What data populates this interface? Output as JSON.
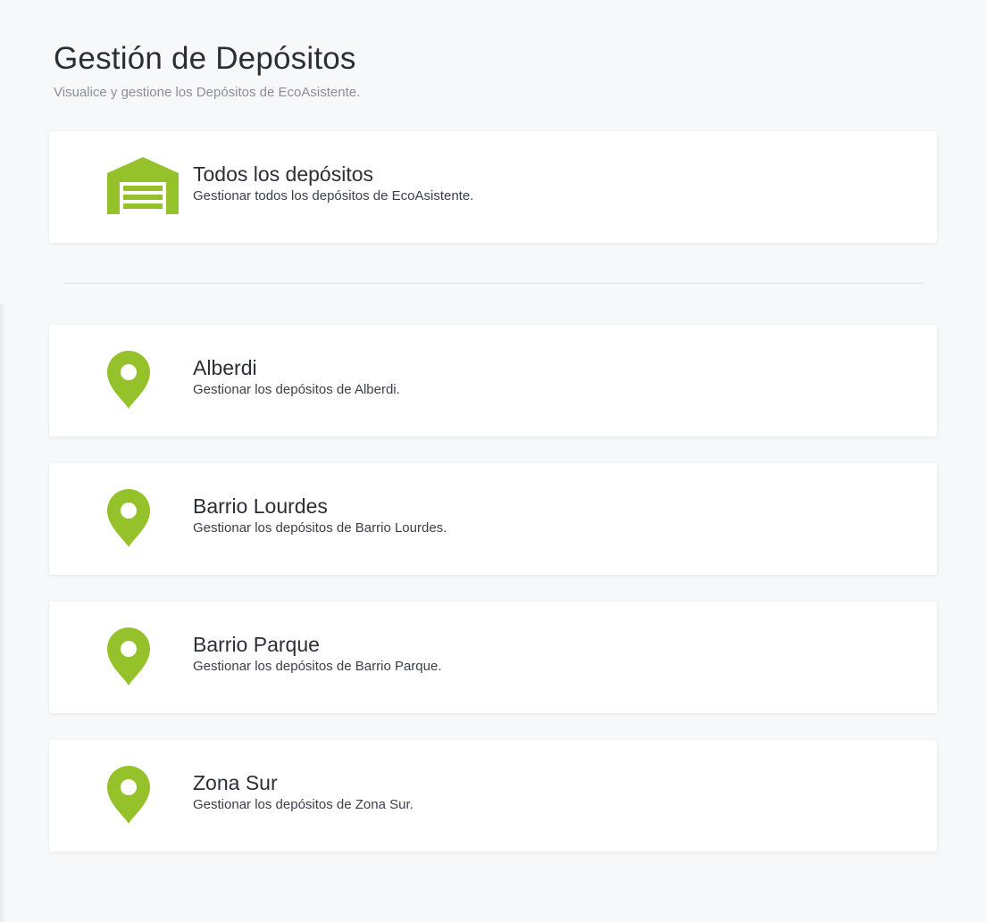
{
  "header": {
    "title": "Gestión de Depósitos",
    "subtitle": "Visualice y gestione los Depósitos de EcoAsistente."
  },
  "colors": {
    "accent": "#95c22b",
    "background": "#f7f8fa",
    "card": "#ffffff"
  },
  "all_deposits": {
    "icon": "warehouse-icon",
    "title": "Todos los depósitos",
    "description": "Gestionar todos los depósitos de EcoAsistente."
  },
  "zones": [
    {
      "icon": "map-pin-icon",
      "title": "Alberdi",
      "description": "Gestionar los depósitos de Alberdi."
    },
    {
      "icon": "map-pin-icon",
      "title": "Barrio Lourdes",
      "description": "Gestionar los depósitos de Barrio Lourdes."
    },
    {
      "icon": "map-pin-icon",
      "title": "Barrio Parque",
      "description": "Gestionar los depósitos de Barrio Parque."
    },
    {
      "icon": "map-pin-icon",
      "title": "Zona Sur",
      "description": "Gestionar los depósitos de Zona Sur."
    }
  ]
}
